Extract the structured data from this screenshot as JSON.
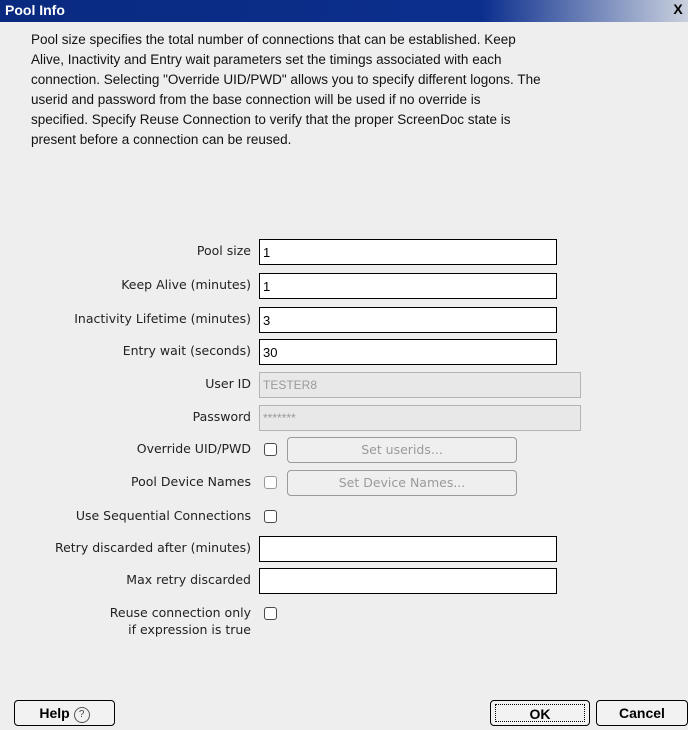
{
  "window": {
    "title": "Pool Info",
    "close_label": "X"
  },
  "description": "Pool size specifies the total number of connections that can be established.  Keep\nAlive, Inactivity and Entry wait parameters set the timings associated with each\nconnection.  Selecting \"Override UID/PWD\" allows you to specify different logons. The\nuserid and password from the base connection will be used if no override is\nspecified. Specify Reuse Connection to verify that the proper ScreenDoc state is\npresent before a connection can be reused.",
  "fields": {
    "pool_size": {
      "label": "Pool size",
      "value": "1"
    },
    "keep_alive": {
      "label": "Keep Alive (minutes)",
      "value": "1"
    },
    "inactivity": {
      "label": "Inactivity Lifetime (minutes)",
      "value": "3"
    },
    "entry_wait": {
      "label": "Entry wait (seconds)",
      "value": "30"
    },
    "user_id": {
      "label": "User ID",
      "value": "TESTER8"
    },
    "password": {
      "label": "Password",
      "value": "*******"
    },
    "override": {
      "label": "Override UID/PWD",
      "button": "Set userids...",
      "checked": false
    },
    "device_names": {
      "label": "Pool Device Names",
      "button": "Set Device Names...",
      "checked": false
    },
    "sequential": {
      "label": "Use Sequential Connections",
      "checked": false
    },
    "retry_after": {
      "label": "Retry discarded after (minutes)",
      "value": ""
    },
    "max_retry": {
      "label": "Max retry discarded",
      "value": ""
    },
    "reuse": {
      "label_line1": "Reuse connection only",
      "label_line2": "if expression is true",
      "checked": false
    }
  },
  "footer": {
    "help_label": "Help",
    "help_icon": "?",
    "ok_label": "OK",
    "cancel_label": "Cancel"
  }
}
